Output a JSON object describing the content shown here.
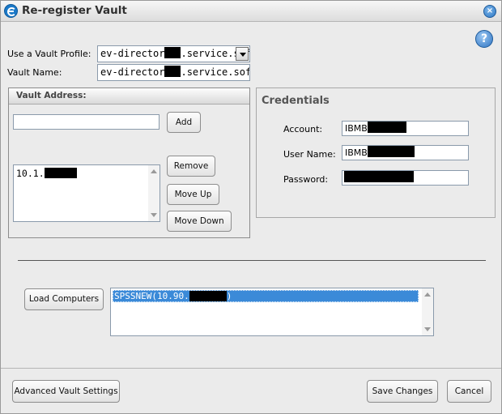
{
  "window": {
    "title": "Re-register Vault",
    "close_glyph": "×",
    "help_glyph": "?"
  },
  "profile": {
    "label": "Use a Vault Profile:",
    "value_prefix": "ev-director",
    "value_suffix": ".service.softla"
  },
  "vault_name": {
    "label": "Vault Name:",
    "value_prefix": "ev-director",
    "value_suffix": ".service.softlayer"
  },
  "vault_address": {
    "group_title": "Vault Address:",
    "input_value": "",
    "add_button": "Add",
    "list_items": [
      "10.1."
    ],
    "remove_button": "Remove",
    "move_up_button": "Move Up",
    "move_down_button": "Move Down"
  },
  "credentials": {
    "title": "Credentials",
    "account_label": "Account:",
    "account_prefix": "IBMB",
    "username_label": "User Name:",
    "username_prefix": "IBMB",
    "password_label": "Password:"
  },
  "computers": {
    "load_button": "Load Computers",
    "selected_item_prefix": "SPSSNEW(10.90.",
    "selected_item_suffix": ")"
  },
  "footer": {
    "advanced_button": "Advanced Vault Settings",
    "save_button": "Save Changes",
    "cancel_button": "Cancel"
  }
}
